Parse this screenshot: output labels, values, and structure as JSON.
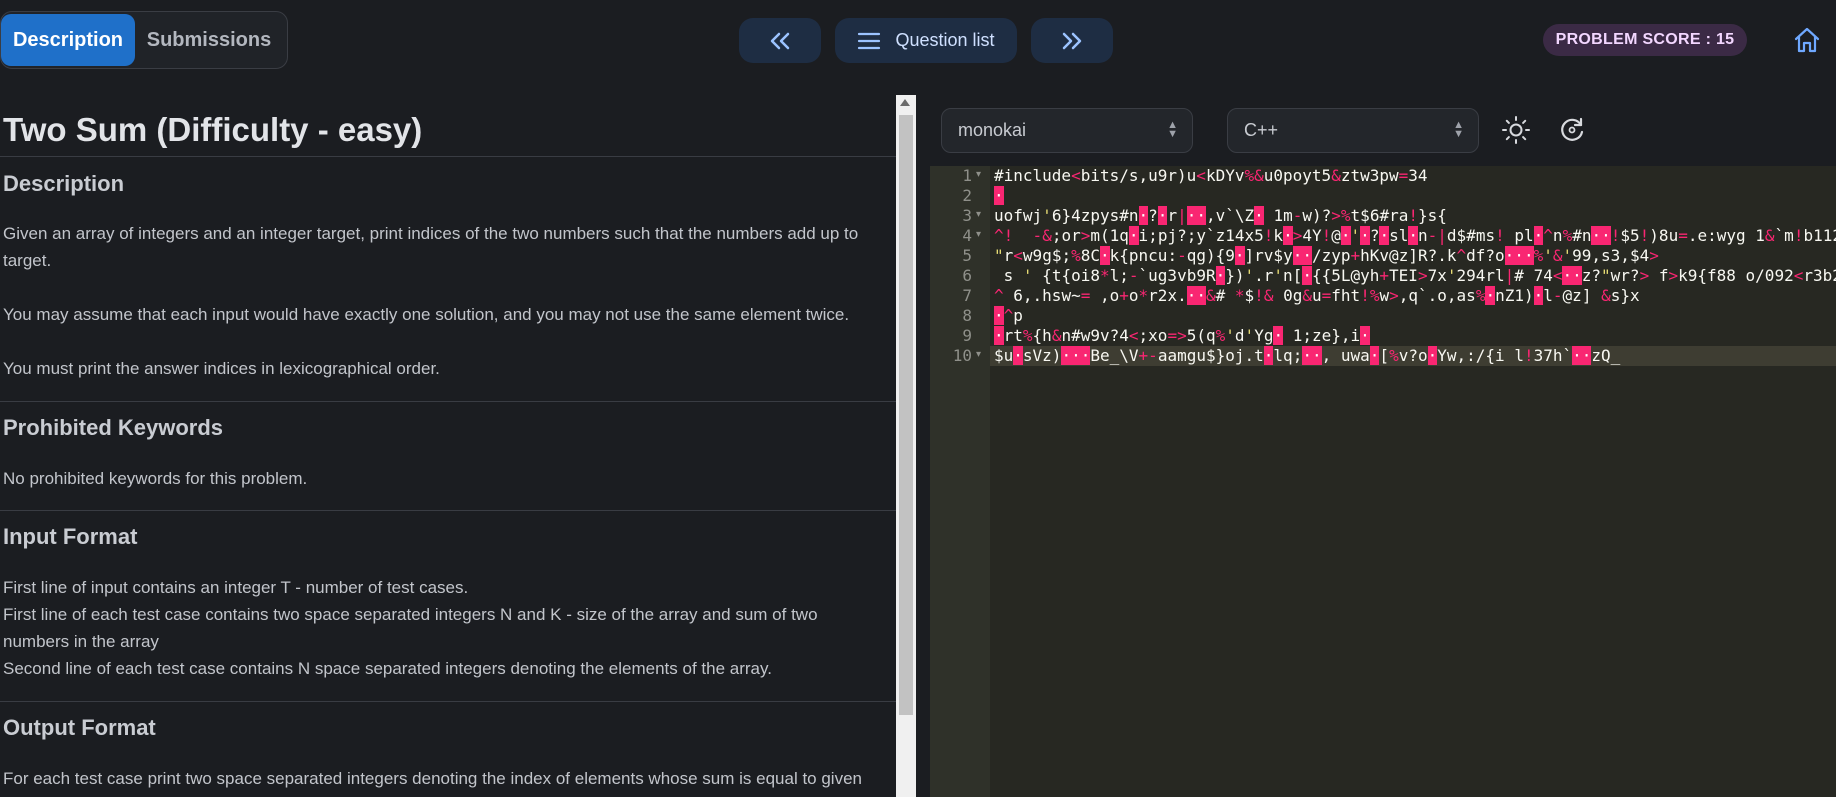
{
  "tabs": {
    "description": "Description",
    "submissions": "Submissions"
  },
  "nav": {
    "question_list": "Question list"
  },
  "score": "PROBLEM SCORE : 15",
  "problem": {
    "title": "Two Sum (Difficulty - easy)",
    "sections": {
      "description": {
        "heading": "Description",
        "p1": "Given an array of integers and an integer target, print indices of the two numbers such that the numbers add up to target.",
        "p2": "You may assume that each input would have exactly one solution, and you may not use the same element twice.",
        "p3": "You must print the answer indices in lexicographical order."
      },
      "prohibited": {
        "heading": "Prohibited Keywords",
        "p1": "No prohibited keywords for this problem."
      },
      "input": {
        "heading": "Input Format",
        "p1": "First line of input contains an integer T - number of test cases.",
        "p2": "First line of each test case contains two space separated integers N and K - size of the array and sum of two numbers in the array",
        "p3": "Second line of each test case contains N space separated integers denoting the elements of the array."
      },
      "output": {
        "heading": "Output Format",
        "p1": "For each test case print two space separated integers denoting the index of elements whose sum is equal to given"
      }
    }
  },
  "editor": {
    "theme": "monokai",
    "language": "C++",
    "line_numbers": [
      "1",
      "2",
      "3",
      "4",
      "5",
      "6",
      "7",
      "8",
      "9",
      "10"
    ],
    "lines": [
      "#include<bits/s,u9r)u<kDYv%&u0poyt5&ztw3pw=34",
      "·",
      "uofwj'6}4zpys#n·?·r|··,v`\\Z· 1m-w)?>%t$6#ra!}s{",
      "^!  -&;or>m(1q·i;pj?;y`z14x5!k·>4Y!@·'·?·sl·n-|d$#ms! pl·^n%#n··!$5!)8u=.e:wyg 1&`m!b112",
      "\"r<w9g$;%8C·k{pncu:-qg){9·]rv$y··/zyp+hKv@z]R?.k^df?o···%'&'99,s3,$4>",
      " s ' {t{oi8*l;-`ug3vb9R·})'.r'n[·{{5L@yh+TEI>7x'294rl|# 74<··z?\"wr?> f>k9{f88 o/092<r3b2",
      "^ 6,.hsw~= ,o+o*r2x.··&# *$!& 0g&u=fht!%w>,q`.o,as%·nZ1)·l-@z] &s}x",
      "·^p",
      "·rt%{h&n#w9v?4<;xo=>5(q%'d'Yg· 1;ze},i·",
      "$u·sVz)···Be_\\V+-aamgu$}oj.t·lq;··, uwa·[%v?o·Yw,:/{i l!37h`··zQ_"
    ]
  },
  "icons": {
    "prev": "double-chevron-left-icon",
    "list": "list-icon",
    "next": "double-chevron-right-icon",
    "home": "home-icon",
    "theme": "sun-icon",
    "reset": "reset-icon"
  }
}
